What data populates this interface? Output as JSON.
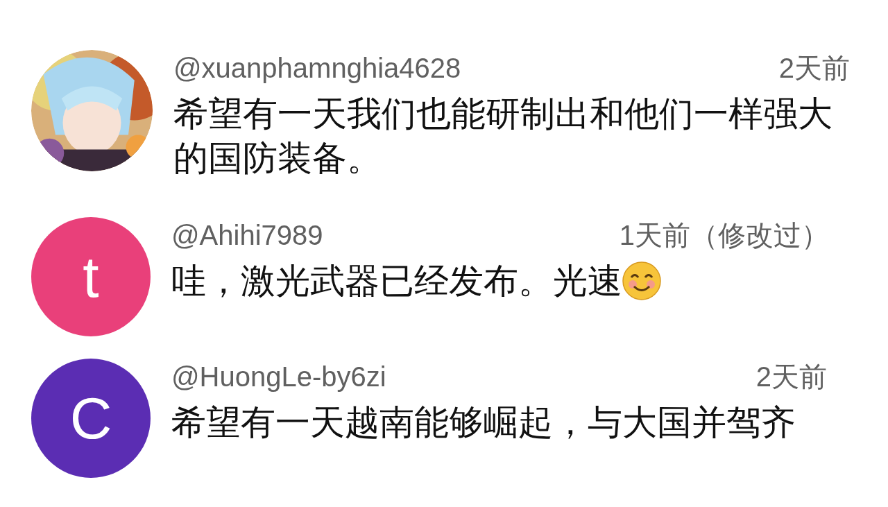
{
  "comments": [
    {
      "username": "@xuanphamnghia4628",
      "time": "2天前",
      "text": "希望有一天我们也能研制出和他们一样强大的国防装备。",
      "emoji": false
    },
    {
      "avatar": {
        "kind": "letter",
        "letter": "t",
        "color": "#e9407a"
      },
      "username": "@Ahihi7989",
      "time": "1天前（修改过）",
      "text": "哇，激光武器已经发布。光速",
      "emoji": true
    },
    {
      "avatar": {
        "kind": "letter",
        "letter": "C",
        "color": "#5b2db3"
      },
      "username": "@HuongLe-by6zi",
      "time": "2天前",
      "text": "希望有一天越南能够崛起，与大国并驾齐",
      "emoji": false
    }
  ]
}
